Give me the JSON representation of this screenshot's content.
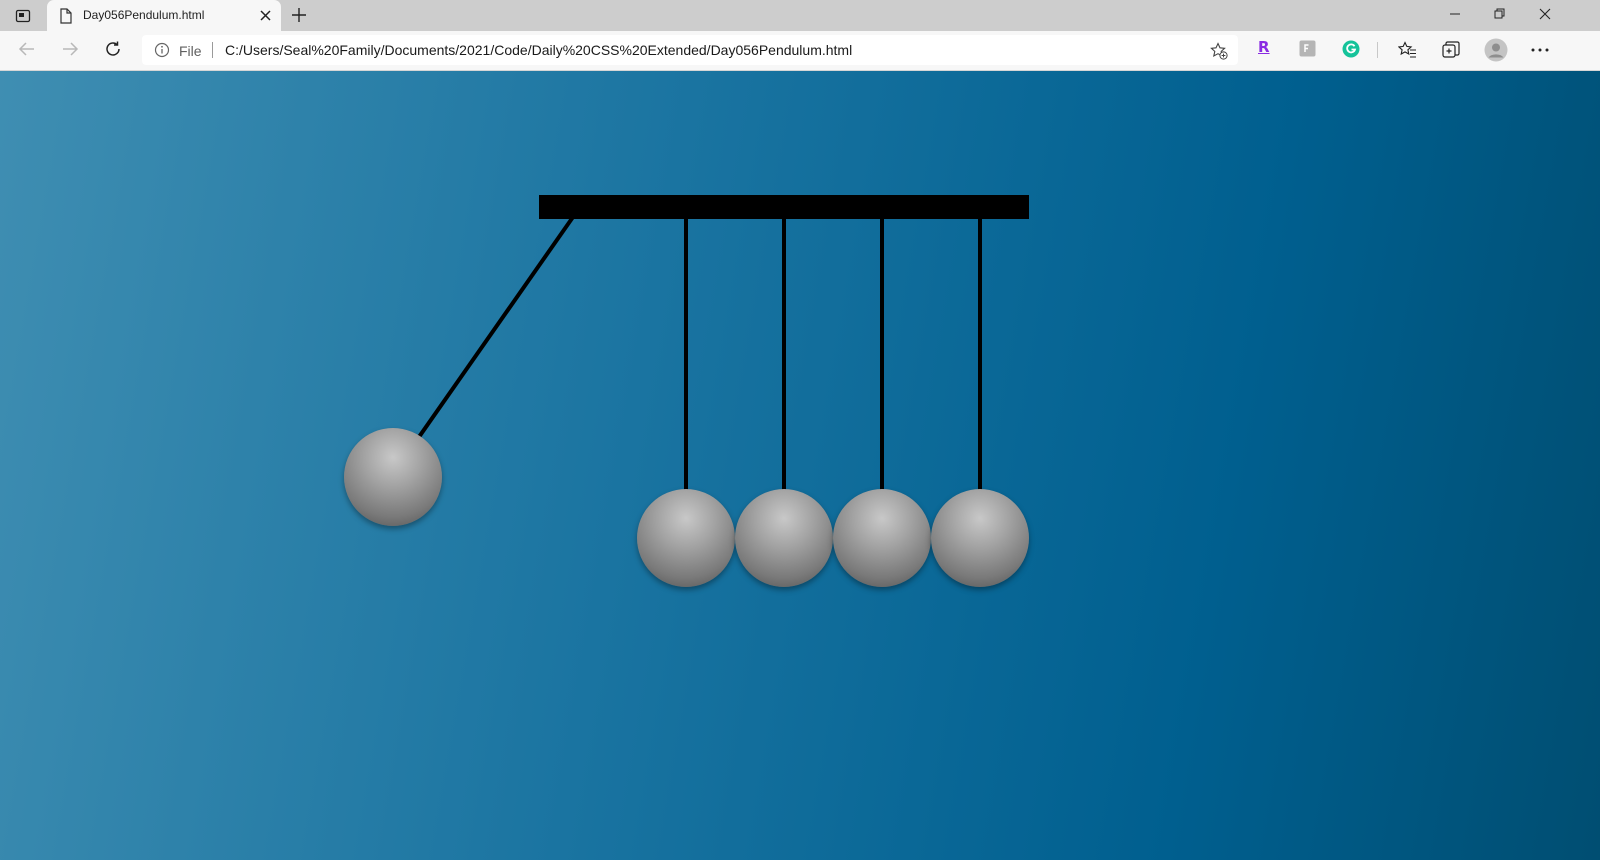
{
  "browser": {
    "tab": {
      "title": "Day056Pendulum.html",
      "icon": "document-icon"
    },
    "new_tab_label": "+",
    "address": {
      "scheme_label": "File",
      "url": "C:/Users/Seal%20Family/Documents/2021/Code/Daily%20CSS%20Extended/Day056Pendulum.html"
    },
    "extensions": {
      "r_label": "R"
    }
  },
  "page": {
    "background": [
      "#3f8eb2",
      "#005f8f",
      "#004e72"
    ],
    "pendulum": {
      "ball_count": 5,
      "ball_color": "#8a8a8a",
      "frame_color": "#000000",
      "first_ball_swing_deg": 35
    }
  }
}
